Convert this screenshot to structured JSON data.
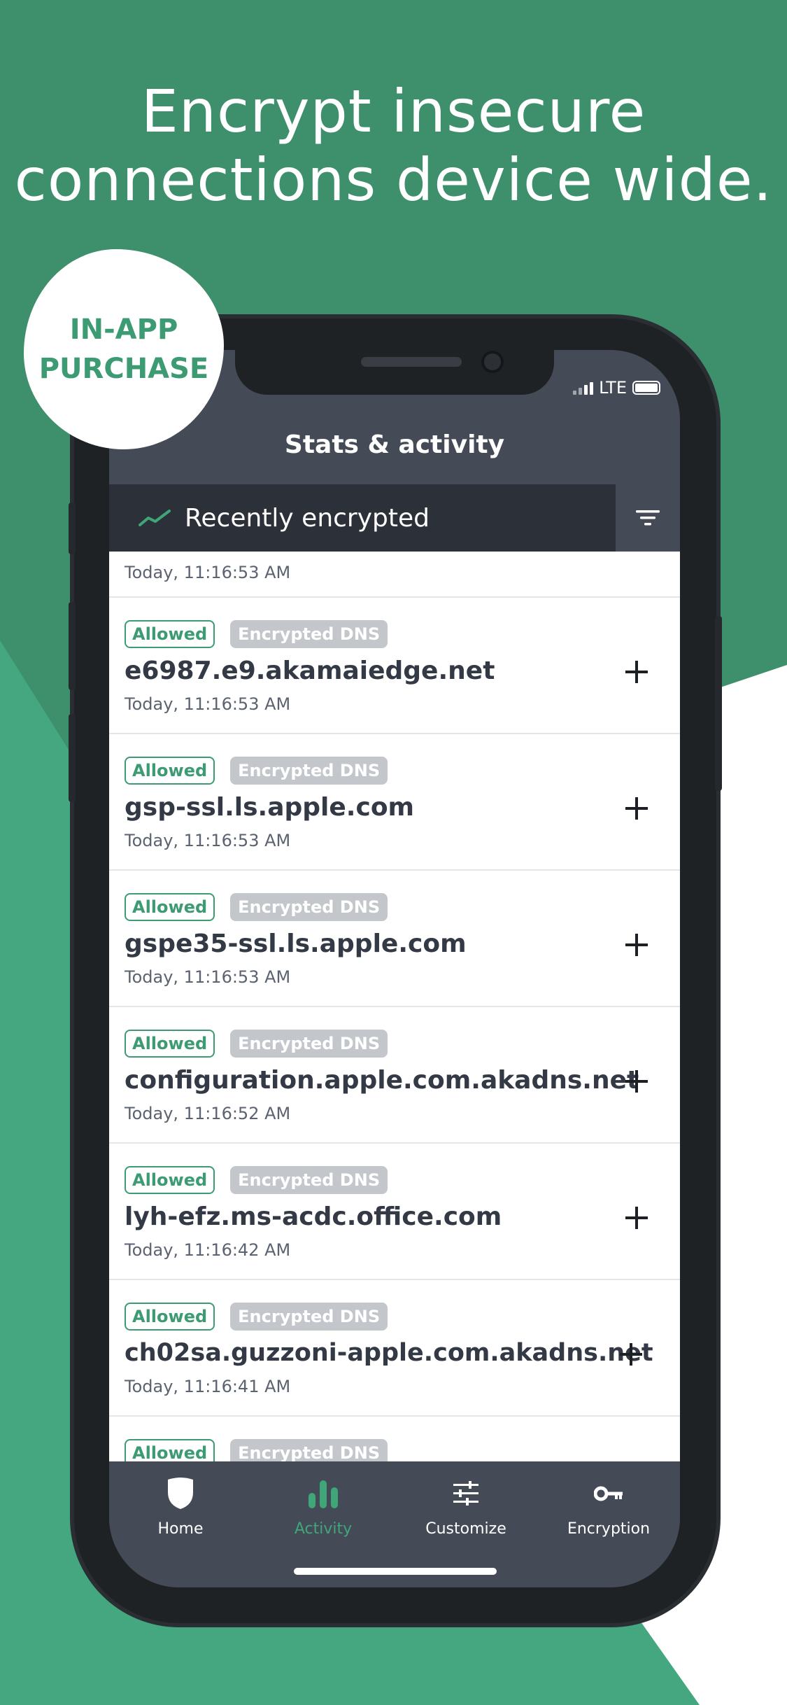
{
  "headline": {
    "line1": "Encrypt insecure",
    "line2": "connections device wide."
  },
  "badge": {
    "line1": "IN-APP",
    "line2": "PURCHASE"
  },
  "status_bar": {
    "network": "LTE"
  },
  "app": {
    "title": "Stats & activity",
    "section_label": "Recently encrypted",
    "section_icon": "trend-line-icon",
    "filter_icon": "filter-icon"
  },
  "list": {
    "partial_top_time": "Today, 11:16:53 AM",
    "items": [
      {
        "status": "Allowed",
        "tag": "Encrypted DNS",
        "host": "e6987.e9.akamaiedge.net",
        "time": "Today, 11:16:53 AM"
      },
      {
        "status": "Allowed",
        "tag": "Encrypted DNS",
        "host": "gsp-ssl.ls.apple.com",
        "time": "Today, 11:16:53 AM"
      },
      {
        "status": "Allowed",
        "tag": "Encrypted DNS",
        "host": "gspe35-ssl.ls.apple.com",
        "time": "Today, 11:16:53 AM"
      },
      {
        "status": "Allowed",
        "tag": "Encrypted DNS",
        "host": "configuration.apple.com.akadns.net",
        "time": "Today, 11:16:52 AM"
      },
      {
        "status": "Allowed",
        "tag": "Encrypted DNS",
        "host": "lyh-efz.ms-acdc.office.com",
        "time": "Today, 11:16:42 AM"
      },
      {
        "status": "Allowed",
        "tag": "Encrypted DNS",
        "host": "ch02sa.guzzoni-apple.com.akadns.net",
        "time": "Today, 11:16:41 AM"
      },
      {
        "status": "Allowed",
        "tag": "Encrypted DNS",
        "host": "",
        "time": ""
      }
    ]
  },
  "tabs": [
    {
      "label": "Home",
      "icon": "shield-icon",
      "active": false
    },
    {
      "label": "Activity",
      "icon": "bar-chart-icon",
      "active": true
    },
    {
      "label": "Customize",
      "icon": "sliders-icon",
      "active": false
    },
    {
      "label": "Encryption",
      "icon": "key-icon",
      "active": false
    }
  ],
  "colors": {
    "background_green": "#3e8f6c",
    "accent_green": "#3c9b73",
    "app_header": "#454b56",
    "section_bar": "#2c3038"
  }
}
